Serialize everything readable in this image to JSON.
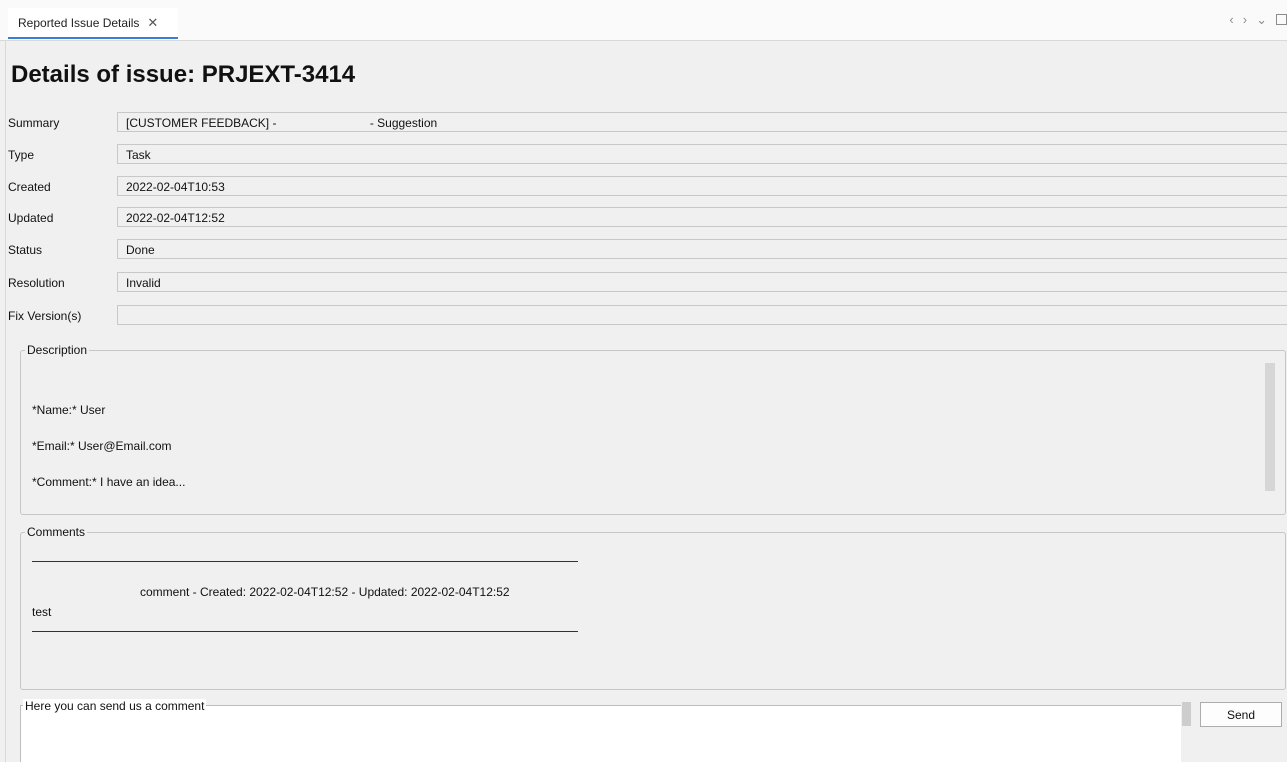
{
  "tab": {
    "label": "Reported Issue Details",
    "close_glyph": "✕"
  },
  "toolbar": {
    "back_glyph": "‹",
    "forward_glyph": "›",
    "menu_glyph": "⌄"
  },
  "title": "Details of issue: PRJEXT-3414",
  "fields": [
    {
      "label": "Summary",
      "value": "[CUSTOMER FEEDBACK] -                            - Suggestion"
    },
    {
      "label": "Type",
      "value": "Task"
    },
    {
      "label": "Created",
      "value": "2022-02-04T10:53"
    },
    {
      "label": "Updated",
      "value": "2022-02-04T12:52"
    },
    {
      "label": "Status",
      "value": "Done"
    },
    {
      "label": "Resolution",
      "value": "Invalid"
    },
    {
      "label": "Fix Version(s)",
      "value": ""
    }
  ],
  "description": {
    "legend": "Description",
    "lines": [
      "*Name:* User",
      "*Email:* User@Email.com",
      "*Comment:* I have an idea..."
    ]
  },
  "comments": {
    "legend": "Comments",
    "entries": [
      {
        "meta": "comment - Created: 2022-02-04T12:52 - Updated: 2022-02-04T12:52",
        "text": "test"
      }
    ]
  },
  "comment_input": {
    "legend": "Here you can send us a comment",
    "value": ""
  },
  "send_label": "Send",
  "colors": {
    "tab_accent": "#3b7fd4",
    "background": "#f0f0f0"
  }
}
